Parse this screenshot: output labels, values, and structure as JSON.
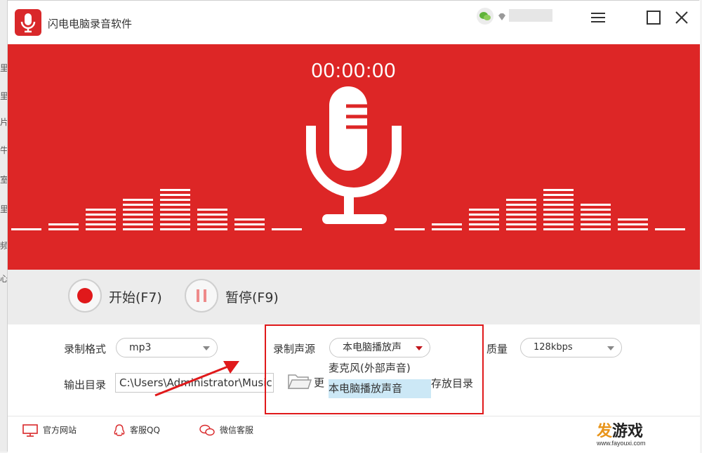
{
  "app": {
    "title": "闪电电脑录音软件"
  },
  "hero": {
    "timer": "00:00:00",
    "eq_levels": [
      1,
      2,
      5,
      7,
      9,
      5,
      3,
      1,
      1,
      2,
      5,
      7,
      9,
      6,
      3,
      1
    ]
  },
  "controls": {
    "start_label": "开始(F7)",
    "pause_label": "暂停(F9)"
  },
  "settings": {
    "format_label": "录制格式",
    "format_value": "mp3",
    "source_label": "录制声源",
    "source_value": "本电脑播放声",
    "quality_label": "质量",
    "quality_value": "128kbps",
    "output_label": "输出目录",
    "output_path": "C:\\Users\\Administrator\\Music",
    "change_dir_label": "更",
    "open_dir_label": "存放目录",
    "source_options": [
      "麦克风(外部声音)",
      "本电脑播放声音"
    ]
  },
  "footer": {
    "website": "官方网站",
    "qq": "客服QQ",
    "wechat": "微信客服"
  },
  "watermark": {
    "title_a": "发",
    "title_b": "游戏",
    "url": "www.fayouxi.com"
  },
  "left_strip": [
    "里",
    "里",
    "片",
    "牛",
    "室",
    "里",
    "频",
    "心"
  ],
  "colors": {
    "brand_red": "#dd2626",
    "highlight_red": "#e0191b",
    "selected_bg": "#cce8f6"
  },
  "icons": [
    "app-mic-logo",
    "wechat-icon",
    "vip-diamond-icon",
    "menu-icon",
    "maximize-icon",
    "close-icon",
    "microphone-icon",
    "record-icon",
    "pause-icon",
    "folder-icon",
    "monitor-icon",
    "qq-icon",
    "wechat-service-icon"
  ]
}
